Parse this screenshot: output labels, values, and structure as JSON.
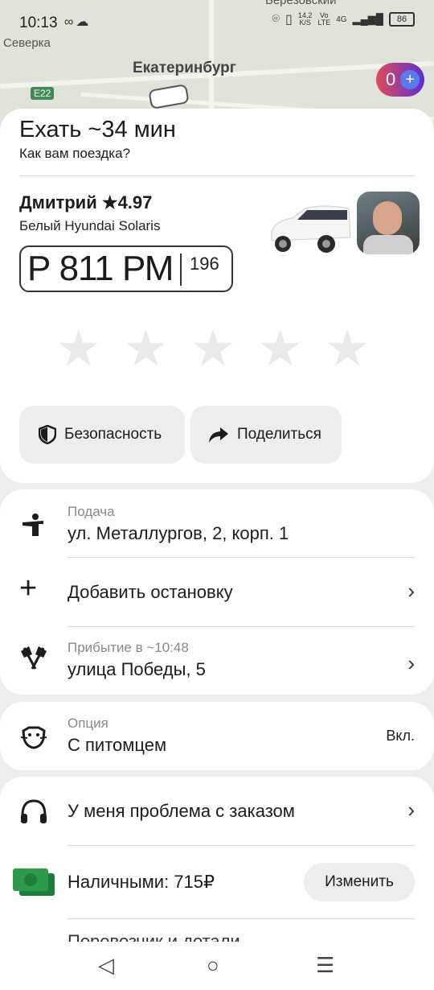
{
  "status_bar": {
    "time": "10:13",
    "speed_value": "14,2",
    "speed_unit": "K/S",
    "vo": "Vo",
    "lte": "LTE",
    "net": "4G",
    "battery": "86"
  },
  "map": {
    "labels": [
      "Берёзовский",
      "Северка",
      "Екатеринбург"
    ],
    "road_badge": "E22"
  },
  "promo": {
    "count": "0"
  },
  "trip": {
    "title": "Ехать ~34 мин",
    "subtitle": "Как вам поездка?"
  },
  "driver": {
    "name": "Дмитрий ★4.97",
    "car": "Белый Hyundai Solaris",
    "plate_number": "Р 811 РМ",
    "plate_region": "196"
  },
  "rating": {
    "max_stars": 5
  },
  "actions": {
    "safety_label": "Безопасность",
    "share_label": "Поделиться"
  },
  "route": {
    "pickup_caption": "Подача",
    "pickup_address": "ул. Металлургов, 2, корп. 1",
    "add_stop": "Добавить остановку",
    "arrival_caption": "Прибытие в ~10:48",
    "destination": "улица Победы, 5"
  },
  "option": {
    "caption": "Опция",
    "value": "С питомцем",
    "state": "Вкл."
  },
  "bottom": {
    "problem": "У меня проблема с заказом",
    "payment": "Наличными: 715₽",
    "change": "Изменить",
    "carrier": "Перевозчик и детали"
  },
  "colors": {
    "accent": "#5b2fd3",
    "promo_start": "#e04a5a",
    "cash_green": "#2e9b4b"
  }
}
